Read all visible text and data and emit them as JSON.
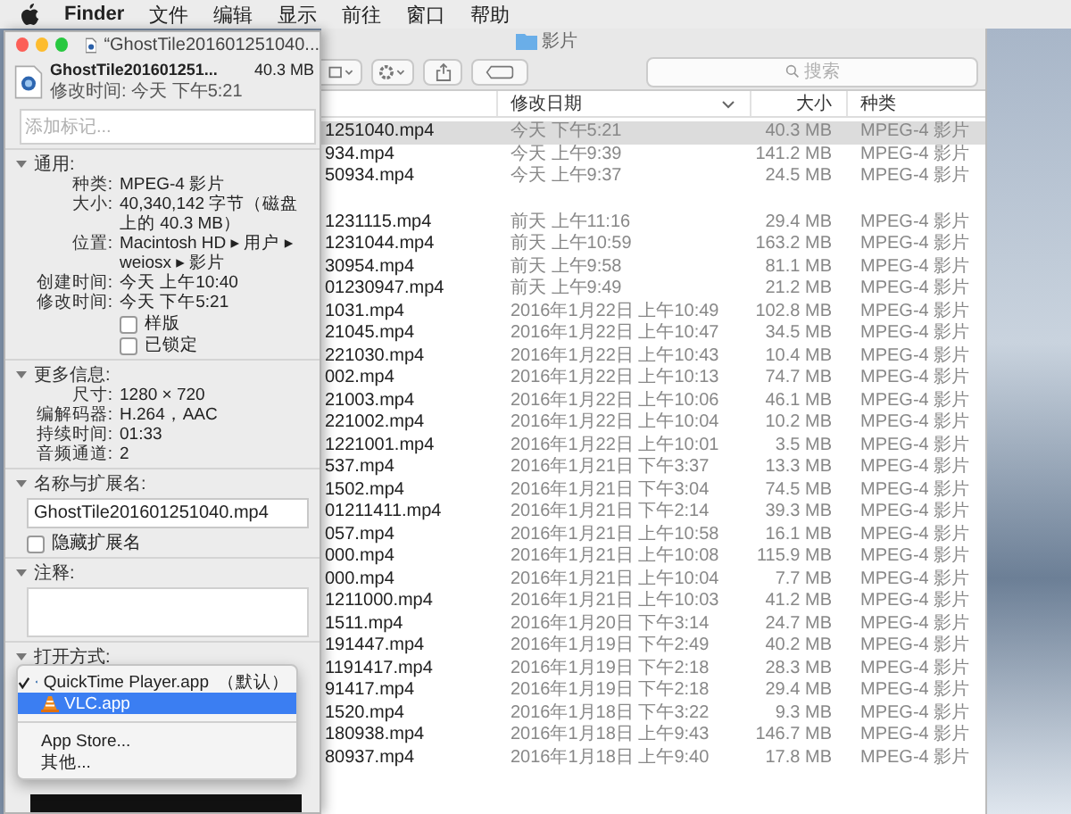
{
  "menu_bar": {
    "app_name": "Finder",
    "items": [
      "文件",
      "编辑",
      "显示",
      "前往",
      "窗口",
      "帮助"
    ]
  },
  "finder": {
    "title": "影片",
    "search_placeholder": "搜索",
    "columns": [
      {
        "label": "修改日期",
        "sorted": true
      },
      {
        "label": "大小",
        "sorted": false
      },
      {
        "label": "种类",
        "sorted": false
      }
    ],
    "groups": [
      {
        "rows": [
          {
            "name": "1251040.mp4",
            "modified": "今天 下午5:21",
            "size": "40.3 MB",
            "kind": "MPEG-4 影片",
            "selected": true
          },
          {
            "name": "934.mp4",
            "modified": "今天 上午9:39",
            "size": "141.2 MB",
            "kind": "MPEG-4 影片",
            "selected": false
          },
          {
            "name": "50934.mp4",
            "modified": "今天 上午9:37",
            "size": "24.5 MB",
            "kind": "MPEG-4 影片",
            "selected": false
          }
        ]
      },
      {
        "rows": [
          {
            "name": "1231115.mp4",
            "modified": "前天 上午11:16",
            "size": "29.4 MB",
            "kind": "MPEG-4 影片",
            "selected": false
          },
          {
            "name": "1231044.mp4",
            "modified": "前天 上午10:59",
            "size": "163.2 MB",
            "kind": "MPEG-4 影片",
            "selected": false
          },
          {
            "name": "30954.mp4",
            "modified": "前天 上午9:58",
            "size": "81.1 MB",
            "kind": "MPEG-4 影片",
            "selected": false
          },
          {
            "name": "01230947.mp4",
            "modified": "前天 上午9:49",
            "size": "21.2 MB",
            "kind": "MPEG-4 影片",
            "selected": false
          },
          {
            "name": "1031.mp4",
            "modified": "2016年1月22日 上午10:49",
            "size": "102.8 MB",
            "kind": "MPEG-4 影片",
            "selected": false
          },
          {
            "name": "21045.mp4",
            "modified": "2016年1月22日 上午10:47",
            "size": "34.5 MB",
            "kind": "MPEG-4 影片",
            "selected": false
          },
          {
            "name": "221030.mp4",
            "modified": "2016年1月22日 上午10:43",
            "size": "10.4 MB",
            "kind": "MPEG-4 影片",
            "selected": false
          },
          {
            "name": "002.mp4",
            "modified": "2016年1月22日 上午10:13",
            "size": "74.7 MB",
            "kind": "MPEG-4 影片",
            "selected": false
          },
          {
            "name": "21003.mp4",
            "modified": "2016年1月22日 上午10:06",
            "size": "46.1 MB",
            "kind": "MPEG-4 影片",
            "selected": false
          },
          {
            "name": "221002.mp4",
            "modified": "2016年1月22日 上午10:04",
            "size": "10.2 MB",
            "kind": "MPEG-4 影片",
            "selected": false
          },
          {
            "name": "1221001.mp4",
            "modified": "2016年1月22日 上午10:01",
            "size": "3.5 MB",
            "kind": "MPEG-4 影片",
            "selected": false
          },
          {
            "name": "537.mp4",
            "modified": "2016年1月21日 下午3:37",
            "size": "13.3 MB",
            "kind": "MPEG-4 影片",
            "selected": false
          },
          {
            "name": "1502.mp4",
            "modified": "2016年1月21日 下午3:04",
            "size": "74.5 MB",
            "kind": "MPEG-4 影片",
            "selected": false
          },
          {
            "name": "01211411.mp4",
            "modified": "2016年1月21日 下午2:14",
            "size": "39.3 MB",
            "kind": "MPEG-4 影片",
            "selected": false
          },
          {
            "name": "057.mp4",
            "modified": "2016年1月21日 上午10:58",
            "size": "16.1 MB",
            "kind": "MPEG-4 影片",
            "selected": false
          },
          {
            "name": "000.mp4",
            "modified": "2016年1月21日 上午10:08",
            "size": "115.9 MB",
            "kind": "MPEG-4 影片",
            "selected": false
          },
          {
            "name": "000.mp4",
            "modified": "2016年1月21日 上午10:04",
            "size": "7.7 MB",
            "kind": "MPEG-4 影片",
            "selected": false
          },
          {
            "name": "1211000.mp4",
            "modified": "2016年1月21日 上午10:03",
            "size": "41.2 MB",
            "kind": "MPEG-4 影片",
            "selected": false
          },
          {
            "name": "1511.mp4",
            "modified": "2016年1月20日 下午3:14",
            "size": "24.7 MB",
            "kind": "MPEG-4 影片",
            "selected": false
          },
          {
            "name": "191447.mp4",
            "modified": "2016年1月19日 下午2:49",
            "size": "40.2 MB",
            "kind": "MPEG-4 影片",
            "selected": false
          },
          {
            "name": "1191417.mp4",
            "modified": "2016年1月19日 下午2:18",
            "size": "28.3 MB",
            "kind": "MPEG-4 影片",
            "selected": false
          },
          {
            "name": "91417.mp4",
            "modified": "2016年1月19日 下午2:18",
            "size": "29.4 MB",
            "kind": "MPEG-4 影片",
            "selected": false
          },
          {
            "name": "1520.mp4",
            "modified": "2016年1月18日 下午3:22",
            "size": "9.3 MB",
            "kind": "MPEG-4 影片",
            "selected": false
          },
          {
            "name": "180938.mp4",
            "modified": "2016年1月18日 上午9:43",
            "size": "146.7 MB",
            "kind": "MPEG-4 影片",
            "selected": false
          },
          {
            "name": "80937.mp4",
            "modified": "2016年1月18日 上午9:40",
            "size": "17.8 MB",
            "kind": "MPEG-4 影片",
            "selected": false
          }
        ]
      }
    ]
  },
  "info_window": {
    "title": "“GhostTile201601251040...",
    "file_name": "GhostTile201601251...",
    "file_size": "40.3 MB",
    "modified": "修改时间: 今天 下午5:21",
    "tags_placeholder": "添加标记...",
    "sections": [
      {
        "kind": "fields",
        "title": "通用:",
        "expanded": true,
        "fields": [
          {
            "label": "种类:",
            "value": "MPEG-4 影片"
          },
          {
            "label": "大小:",
            "value": "40,340,142 字节（磁盘上的 40.3 MB）"
          },
          {
            "label": "位置:",
            "value": "Macintosh HD ▸ 用户 ▸ weiosx ▸ 影片"
          },
          {
            "label": "创建时间:",
            "value": "今天 上午10:40"
          },
          {
            "label": "修改时间:",
            "value": "今天 下午5:21"
          }
        ],
        "checkboxes": [
          {
            "label": "样版",
            "checked": false
          },
          {
            "label": "已锁定",
            "checked": false
          }
        ]
      },
      {
        "kind": "fields",
        "title": "更多信息:",
        "expanded": true,
        "fields": [
          {
            "label": "尺寸:",
            "value": "1280 × 720"
          },
          {
            "label": "编解码器:",
            "value": "H.264，AAC"
          },
          {
            "label": "持续时间:",
            "value": "01:33"
          },
          {
            "label": "音频通道:",
            "value": "2"
          }
        ]
      },
      {
        "kind": "name",
        "title": "名称与扩展名:",
        "expanded": true,
        "value": "GhostTile201601251040.mp4",
        "checkboxes": [
          {
            "label": "隐藏扩展名",
            "checked": false
          }
        ]
      },
      {
        "kind": "comments",
        "title": "注释:",
        "expanded": true
      },
      {
        "kind": "open_with",
        "title": "打开方式:",
        "expanded": true
      }
    ]
  },
  "open_with_menu": {
    "items": [
      {
        "kind": "app",
        "label": "QuickTime Player.app",
        "suffix": "（默认）",
        "checked": true,
        "selected": false
      },
      {
        "kind": "app",
        "label": "VLC.app",
        "checked": false,
        "selected": true
      },
      {
        "kind": "separator"
      },
      {
        "kind": "text",
        "label": "App Store...",
        "checked": false,
        "selected": false
      },
      {
        "kind": "text",
        "label": "其他...",
        "checked": false,
        "selected": false
      }
    ]
  }
}
